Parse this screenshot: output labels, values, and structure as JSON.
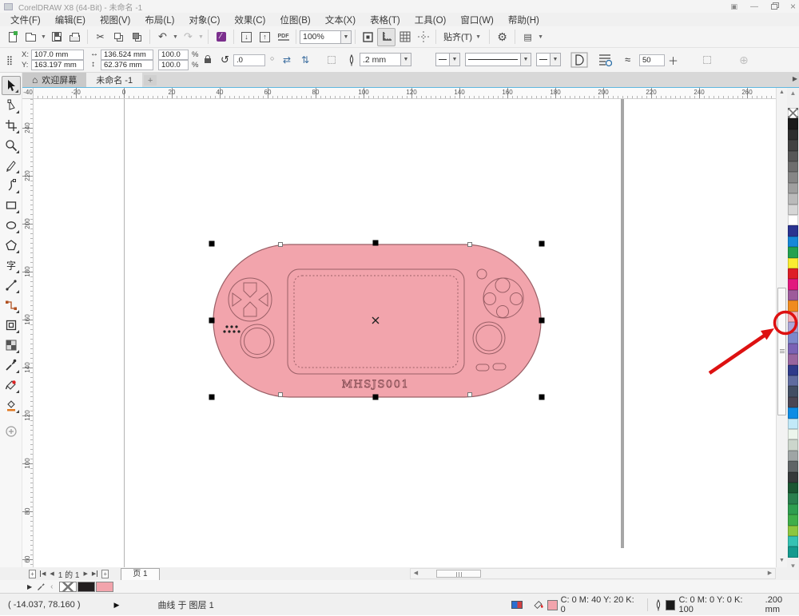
{
  "window": {
    "title": "CorelDRAW X8 (64-Bit) - 未命名 -1"
  },
  "menubar": {
    "items": [
      "文件(F)",
      "编辑(E)",
      "视图(V)",
      "布局(L)",
      "对象(C)",
      "效果(C)",
      "位图(B)",
      "文本(X)",
      "表格(T)",
      "工具(O)",
      "窗口(W)",
      "帮助(H)"
    ]
  },
  "toolbar": {
    "zoom_value": "100%",
    "snap_label": "贴齐(T)",
    "pdf_label": "PDF"
  },
  "propbar": {
    "x_label": "X:",
    "x_value": "107.0 mm",
    "y_label": "Y:",
    "y_value": "163.197 mm",
    "width_value": "136.524 mm",
    "height_value": "62.376 mm",
    "scale_h": "100.0",
    "scale_v": "100.0",
    "pct": "%",
    "rotation_value": ".0",
    "outline_width": ".2 mm",
    "corner_value": "50",
    "approx": "≈"
  },
  "tabs": {
    "welcome": "欢迎屏幕",
    "document": "未命名 -1",
    "new_tab": "+"
  },
  "rulers": {
    "h_labels": [
      "-40",
      "-20",
      "0",
      "20",
      "40",
      "60",
      "80",
      "100",
      "120",
      "140",
      "160",
      "180",
      "200",
      "220",
      "240",
      "260"
    ],
    "v_labels": [
      "240",
      "220",
      "200",
      "180",
      "160",
      "140",
      "120",
      "100",
      "80",
      "60"
    ]
  },
  "canvas": {
    "console_label": "MHSJS001",
    "body_color": "#F2A4AC",
    "outline_color": "#9A5F66"
  },
  "palette": {
    "colors": [
      "none",
      "#1a1a1a",
      "#2d2d2d",
      "#414141",
      "#575757",
      "#6e6e6e",
      "#868686",
      "#9f9f9f",
      "#bababa",
      "#d6d6d6",
      "#ffffff",
      "#2a3390",
      "#1688d8",
      "#22a14f",
      "#f9ec31",
      "#de1f26",
      "#e2197e",
      "#9d5a9b",
      "#f08b1e",
      "#f5b1b7",
      "#aca7d8",
      "#7d88cb",
      "#7a62b5",
      "#97659e",
      "#2e3a8a",
      "#5f6b9f",
      "#414d63",
      "#4a4553",
      "#0e8ce4",
      "#c2e9f8",
      "#ecf5ec",
      "#ccd6cc",
      "#9fa5a5",
      "#5f6466",
      "#35393a",
      "#1a5632",
      "#2a7f4e",
      "#2f9e50",
      "#3fae4a",
      "#8dc63f",
      "#35c2b3",
      "#149a8e"
    ],
    "circled_color": "#f5b1b7"
  },
  "pagebar": {
    "page_info": "1 的 1",
    "page_tab": "页 1"
  },
  "docpalette": {
    "colors": [
      "none",
      "#231f20",
      "#f2a4ac"
    ]
  },
  "statusbar": {
    "coords": "( -14.037, 78.160 )",
    "object_info": "曲线 于 图层 1",
    "fill_cmyk": "C: 0 M: 40 Y: 20 K: 0",
    "outline_cmyk": "C: 0 M: 0 Y: 0 K: 100",
    "outline_width": ".200 mm",
    "fill_color": "#f2a4ac",
    "outline_color": "#1a1a1a"
  }
}
